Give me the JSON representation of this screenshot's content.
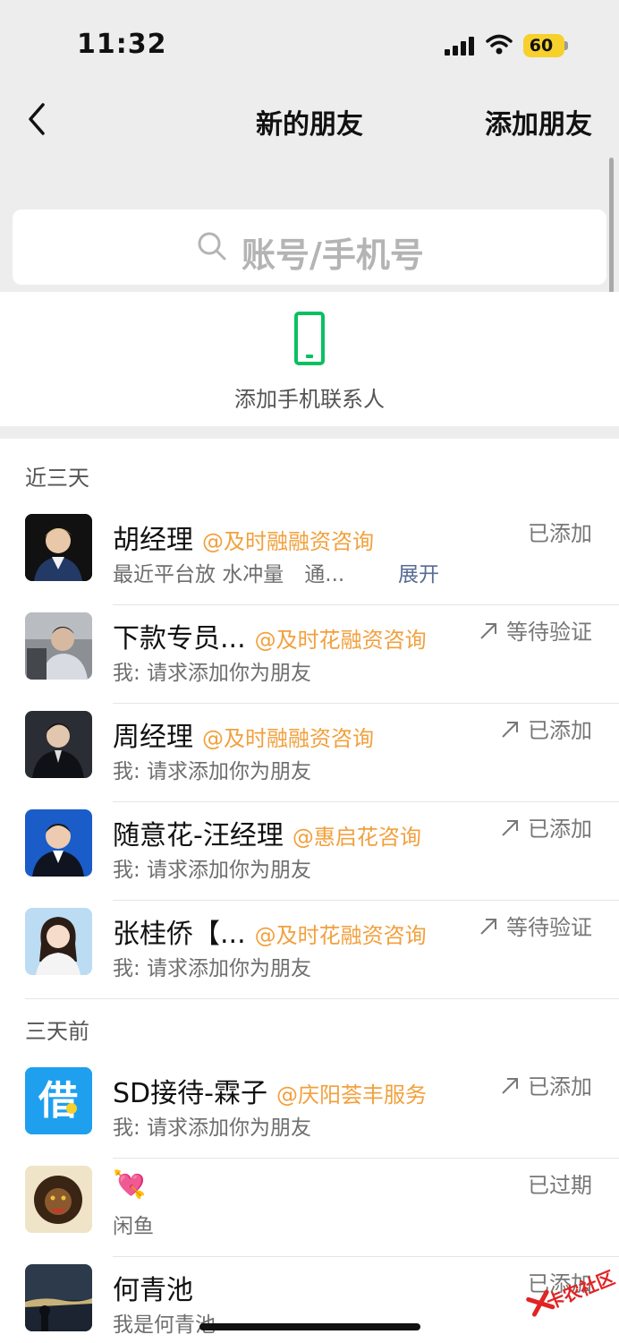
{
  "status_bar": {
    "time": "11:32",
    "battery": "60"
  },
  "nav": {
    "title": "新的朋友",
    "action": "添加朋友"
  },
  "search": {
    "placeholder": "账号/手机号"
  },
  "phone_contacts": {
    "label": "添加手机联系人"
  },
  "sections": [
    {
      "header": "近三天",
      "rows": [
        {
          "name": "胡经理",
          "org": "@及时融融资咨询",
          "subtitle": "最近平台放 水冲量　通...",
          "expand": "展开",
          "status": "已添加",
          "arrow": false
        },
        {
          "name": "下款专员...",
          "org": "@及时花融资咨询",
          "subtitle": "我: 请求添加你为朋友",
          "status": "等待验证",
          "arrow": true
        },
        {
          "name": "周经理",
          "org": "@及时融融资咨询",
          "subtitle": "我: 请求添加你为朋友",
          "status": "已添加",
          "arrow": true
        },
        {
          "name": "随意花-汪经理",
          "org": "@惠启花咨询",
          "subtitle": "我: 请求添加你为朋友",
          "status": "已添加",
          "arrow": true
        },
        {
          "name": "张桂侨【...",
          "org": "@及时花融资咨询",
          "subtitle": "我: 请求添加你为朋友",
          "status": "等待验证",
          "arrow": true
        }
      ]
    },
    {
      "header": "三天前",
      "rows": [
        {
          "name": "SD接待-霖子",
          "org": "@庆阳荟丰服务",
          "subtitle": "我: 请求添加你为朋友",
          "status": "已添加",
          "arrow": true,
          "avatar_glyph": "借"
        },
        {
          "name": "💘",
          "org": "",
          "subtitle": "闲鱼",
          "status": "已过期",
          "arrow": false
        },
        {
          "name": "何青池",
          "org": "",
          "subtitle": "我是何青池",
          "status": "已添加",
          "arrow": false
        }
      ]
    }
  ],
  "watermark": "卡农社区",
  "colors": {
    "accent_orange": "#f2a03d",
    "link_blue": "#576b95",
    "phone_green": "#07c160",
    "battery_yellow": "#f7d02c"
  }
}
